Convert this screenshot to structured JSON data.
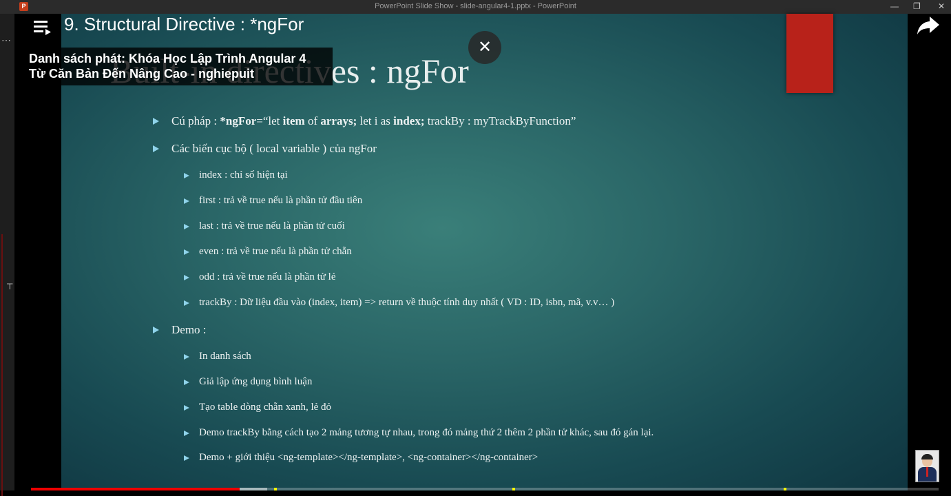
{
  "window": {
    "title": "PowerPoint Slide Show  -  slide-angular4-1.pptx - PowerPoint",
    "app_icon_letter": "P",
    "controls": [
      "—",
      "❐",
      "✕"
    ]
  },
  "player": {
    "video_title": "9. Structural Directive : *ngFor",
    "playlist_line1": "Danh sách phát: Khóa Học Lập Trình Angular 4",
    "playlist_line2": "Từ Căn Bản Đến Nâng Cao - nghiepuit",
    "close_glyph": "✕",
    "progress_played": 0.23,
    "progress_buffered": 0.26
  },
  "slide": {
    "title": "Built-in directives : ngFor",
    "b1": {
      "prefix": "Cú pháp : ",
      "kw1": "*ngFor",
      "t1": "=“let ",
      "kw2": "item",
      "t2": " of ",
      "kw3": "arrays;",
      "t3": " let i as ",
      "kw4": "index;",
      "t4": " trackBy : myTrackByFunction”"
    },
    "b2": "Các biến cục bộ ( local variable ) của ngFor",
    "b2_items": [
      "index : chỉ số hiện tại",
      "first : trả về true nếu là phần tử đầu tiên",
      "last : trả về true nếu là phần tử cuối",
      "even : trả về true nếu là phần tử chẵn",
      "odd : trả về true nếu là phần tử lẻ",
      "trackBy : Dữ liệu đầu vào (index, item) => return về thuộc tính duy nhất ( VD : ID, isbn, mã, v.v… )"
    ],
    "b3": "Demo :",
    "b3_items": [
      "In danh sách",
      "Giả lập ứng dụng bình luận",
      "Tạo table dòng chẵn xanh, lẻ đỏ",
      "Demo trackBy bằng cách tạo 2 mảng tương tự nhau, trong đó mảng thứ 2 thêm 2 phần tử khác, sau đó gán lại.",
      "Demo + giới thiệu <ng-template></ng-template>, <ng-container></ng-container>"
    ]
  }
}
